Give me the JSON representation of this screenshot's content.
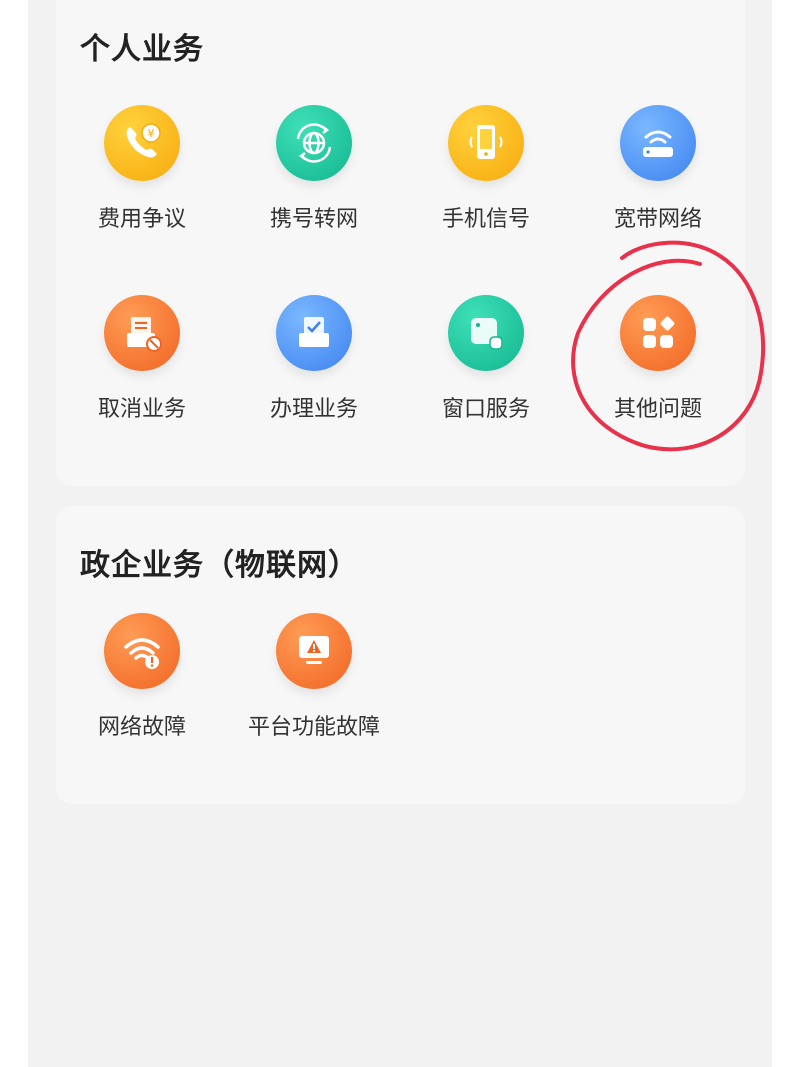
{
  "personal": {
    "title": "个人业务",
    "items": [
      {
        "label": "费用争议",
        "icon": "phone-yuan-icon",
        "color": "#f7a90b"
      },
      {
        "label": "携号转网",
        "icon": "globe-transfer-icon",
        "color": "#12b58e"
      },
      {
        "label": "手机信号",
        "icon": "mobile-signal-icon",
        "color": "#f7a90b"
      },
      {
        "label": "宽带网络",
        "icon": "broadband-router-icon",
        "color": "#3d82ef"
      },
      {
        "label": "取消业务",
        "icon": "cancel-document-icon",
        "color": "#f06422"
      },
      {
        "label": "办理业务",
        "icon": "apply-document-icon",
        "color": "#3d82ef"
      },
      {
        "label": "窗口服务",
        "icon": "window-service-icon",
        "color": "#12b58e"
      },
      {
        "label": "其他问题",
        "icon": "other-apps-icon",
        "color": "#f06422"
      }
    ]
  },
  "gov": {
    "title": "政企业务（物联网）",
    "items": [
      {
        "label": "网络故障",
        "icon": "wifi-warning-icon",
        "color": "#f06422"
      },
      {
        "label": "平台功能故障",
        "icon": "monitor-warning-icon",
        "color": "#f06422"
      }
    ]
  },
  "annotation": {
    "color": "#e8324b"
  }
}
